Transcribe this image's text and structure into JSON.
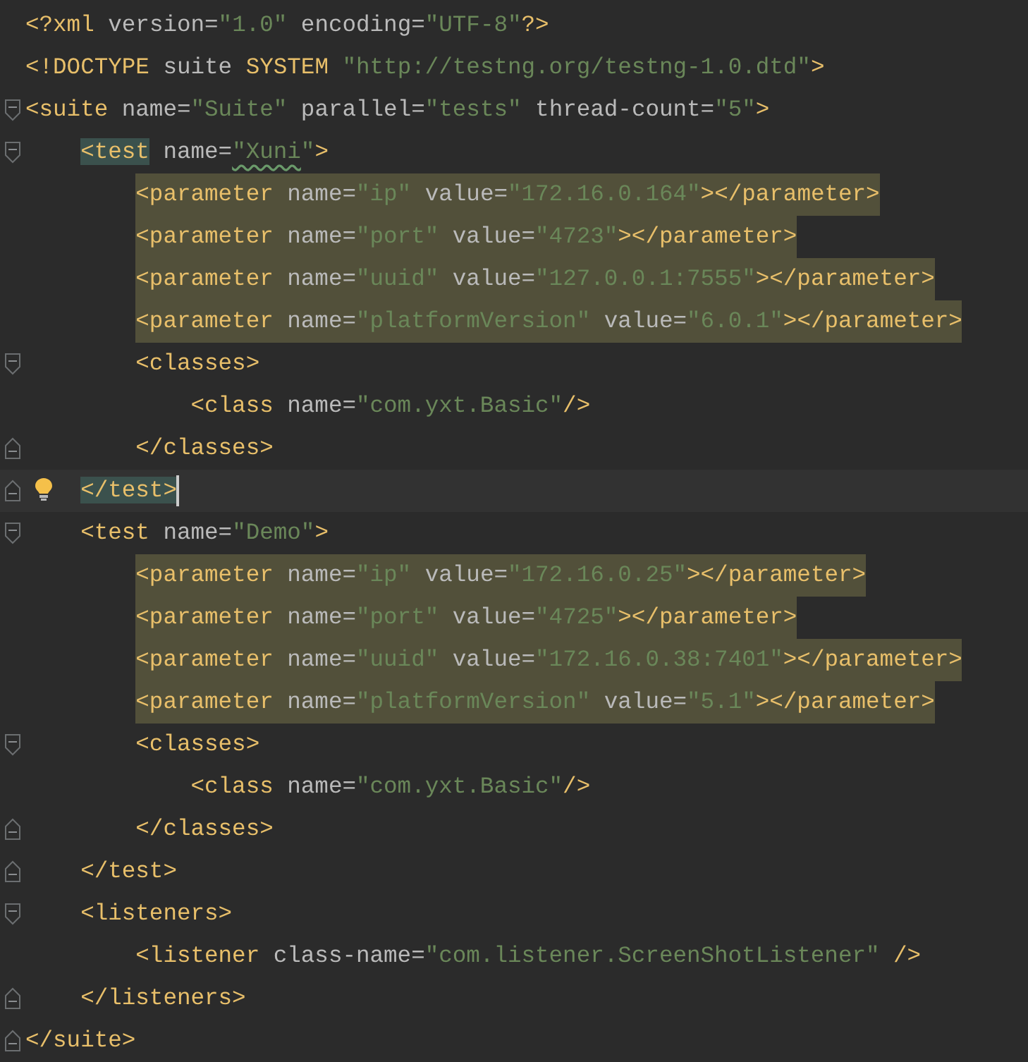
{
  "lines": [
    {
      "tokens": [
        {
          "kind": "tag",
          "text": "<?xml"
        },
        {
          "kind": "attr",
          "text": " version="
        },
        {
          "kind": "value",
          "text": "\"1.0\""
        },
        {
          "kind": "attr",
          "text": " encoding="
        },
        {
          "kind": "value",
          "text": "\"UTF-8\""
        },
        {
          "kind": "tag",
          "text": "?>"
        }
      ]
    },
    {
      "tokens": [
        {
          "kind": "tag",
          "text": "<!DOCTYPE"
        },
        {
          "kind": "attr",
          "text": " suite "
        },
        {
          "kind": "tag",
          "text": "SYSTEM "
        },
        {
          "kind": "value",
          "text": "\"http://testng.org/testng-1.0.dtd\""
        },
        {
          "kind": "tag",
          "text": ">"
        }
      ]
    },
    {
      "fold_start": true,
      "tokens": [
        {
          "kind": "tag",
          "text": "<suite"
        },
        {
          "kind": "attr",
          "text": " name="
        },
        {
          "kind": "value",
          "text": "\"Suite\""
        },
        {
          "kind": "attr",
          "text": " parallel="
        },
        {
          "kind": "value",
          "text": "\"tests\""
        },
        {
          "kind": "attr",
          "text": " thread-count="
        },
        {
          "kind": "value",
          "text": "\"5\""
        },
        {
          "kind": "tag",
          "text": ">"
        }
      ],
      "children": [
        {
          "fold_start": true,
          "tokens": [
            {
              "kind": "tag",
              "text": "<test",
              "matched": true
            },
            {
              "kind": "attr",
              "text": " name="
            },
            {
              "kind": "value",
              "text": "\"Xuni",
              "typo": true
            },
            {
              "kind": "value",
              "text": "\""
            },
            {
              "kind": "tag",
              "text": ">"
            }
          ],
          "children": [
            {
              "highlighted": true,
              "tokens": [
                {
                  "kind": "tag",
                  "text": "<parameter"
                },
                {
                  "kind": "attr",
                  "text": " name="
                },
                {
                  "kind": "value",
                  "text": "\"ip\""
                },
                {
                  "kind": "attr",
                  "text": " value="
                },
                {
                  "kind": "value",
                  "text": "\"172.16.0.164\""
                },
                {
                  "kind": "tag",
                  "text": "></parameter>"
                }
              ]
            },
            {
              "highlighted": true,
              "tokens": [
                {
                  "kind": "tag",
                  "text": "<parameter"
                },
                {
                  "kind": "attr",
                  "text": " name="
                },
                {
                  "kind": "value",
                  "text": "\"port\""
                },
                {
                  "kind": "attr",
                  "text": " value="
                },
                {
                  "kind": "value",
                  "text": "\"4723\""
                },
                {
                  "kind": "tag",
                  "text": "></parameter>"
                }
              ]
            },
            {
              "highlighted": true,
              "tokens": [
                {
                  "kind": "tag",
                  "text": "<parameter"
                },
                {
                  "kind": "attr",
                  "text": " name="
                },
                {
                  "kind": "value",
                  "text": "\"uuid\""
                },
                {
                  "kind": "attr",
                  "text": " value="
                },
                {
                  "kind": "value",
                  "text": "\"127.0.0.1:7555\""
                },
                {
                  "kind": "tag",
                  "text": "></parameter>"
                }
              ]
            },
            {
              "highlighted": true,
              "tokens": [
                {
                  "kind": "tag",
                  "text": "<parameter"
                },
                {
                  "kind": "attr",
                  "text": " name="
                },
                {
                  "kind": "value",
                  "text": "\"platformVersion\""
                },
                {
                  "kind": "attr",
                  "text": " value="
                },
                {
                  "kind": "value",
                  "text": "\"6.0.1\""
                },
                {
                  "kind": "tag",
                  "text": "></parameter>"
                }
              ]
            },
            {
              "fold_start": true,
              "tokens": [
                {
                  "kind": "tag",
                  "text": "<classes>"
                }
              ],
              "children": [
                {
                  "tokens": [
                    {
                      "kind": "tag",
                      "text": "<class"
                    },
                    {
                      "kind": "attr",
                      "text": " name="
                    },
                    {
                      "kind": "value",
                      "text": "\"com.yxt.Basic\""
                    },
                    {
                      "kind": "tag",
                      "text": "/>"
                    }
                  ]
                }
              ]
            },
            {
              "fold_end": true,
              "tokens": [
                {
                  "kind": "tag",
                  "text": "</classes>"
                }
              ]
            }
          ]
        },
        {
          "fold_end": true,
          "current": true,
          "hint": true,
          "tokens": [
            {
              "kind": "tag",
              "text": "</test>",
              "matched": true
            }
          ]
        },
        {
          "fold_start": true,
          "tokens": [
            {
              "kind": "tag",
              "text": "<test"
            },
            {
              "kind": "attr",
              "text": " name="
            },
            {
              "kind": "value",
              "text": "\"Demo\""
            },
            {
              "kind": "tag",
              "text": ">"
            }
          ],
          "children": [
            {
              "highlighted": true,
              "tokens": [
                {
                  "kind": "tag",
                  "text": "<parameter"
                },
                {
                  "kind": "attr",
                  "text": " name="
                },
                {
                  "kind": "value",
                  "text": "\"ip\""
                },
                {
                  "kind": "attr",
                  "text": " value="
                },
                {
                  "kind": "value",
                  "text": "\"172.16.0.25\""
                },
                {
                  "kind": "tag",
                  "text": "></parameter>"
                }
              ]
            },
            {
              "highlighted": true,
              "tokens": [
                {
                  "kind": "tag",
                  "text": "<parameter"
                },
                {
                  "kind": "attr",
                  "text": " name="
                },
                {
                  "kind": "value",
                  "text": "\"port\""
                },
                {
                  "kind": "attr",
                  "text": " value="
                },
                {
                  "kind": "value",
                  "text": "\"4725\""
                },
                {
                  "kind": "tag",
                  "text": "></parameter>"
                }
              ]
            },
            {
              "highlighted": true,
              "tokens": [
                {
                  "kind": "tag",
                  "text": "<parameter"
                },
                {
                  "kind": "attr",
                  "text": " name="
                },
                {
                  "kind": "value",
                  "text": "\"uuid\""
                },
                {
                  "kind": "attr",
                  "text": " value="
                },
                {
                  "kind": "value",
                  "text": "\"172.16.0.38:7401\""
                },
                {
                  "kind": "tag",
                  "text": "></parameter>"
                }
              ]
            },
            {
              "highlighted": true,
              "tokens": [
                {
                  "kind": "tag",
                  "text": "<parameter"
                },
                {
                  "kind": "attr",
                  "text": " name="
                },
                {
                  "kind": "value",
                  "text": "\"platformVersion\""
                },
                {
                  "kind": "attr",
                  "text": " value="
                },
                {
                  "kind": "value",
                  "text": "\"5.1\""
                },
                {
                  "kind": "tag",
                  "text": "></parameter>"
                }
              ]
            },
            {
              "fold_start": true,
              "tokens": [
                {
                  "kind": "tag",
                  "text": "<classes>"
                }
              ],
              "children": [
                {
                  "tokens": [
                    {
                      "kind": "tag",
                      "text": "<class"
                    },
                    {
                      "kind": "attr",
                      "text": " name="
                    },
                    {
                      "kind": "value",
                      "text": "\"com.yxt.Basic\""
                    },
                    {
                      "kind": "tag",
                      "text": "/>"
                    }
                  ]
                }
              ]
            },
            {
              "fold_end": true,
              "tokens": [
                {
                  "kind": "tag",
                  "text": "</classes>"
                }
              ]
            }
          ]
        },
        {
          "fold_end": true,
          "tokens": [
            {
              "kind": "tag",
              "text": "</test>"
            }
          ]
        },
        {
          "fold_start": true,
          "tokens": [
            {
              "kind": "tag",
              "text": "<listeners>"
            }
          ],
          "children": [
            {
              "tokens": [
                {
                  "kind": "tag",
                  "text": "<listener"
                },
                {
                  "kind": "attr",
                  "text": " class-name="
                },
                {
                  "kind": "value",
                  "text": "\"com.listener.ScreenShotListener\""
                },
                {
                  "kind": "tag",
                  "text": " />"
                }
              ]
            }
          ]
        },
        {
          "fold_end": true,
          "tokens": [
            {
              "kind": "tag",
              "text": "</listeners>"
            }
          ]
        }
      ]
    },
    {
      "fold_end": true,
      "tokens": [
        {
          "kind": "tag",
          "text": "</suite>"
        }
      ]
    }
  ]
}
